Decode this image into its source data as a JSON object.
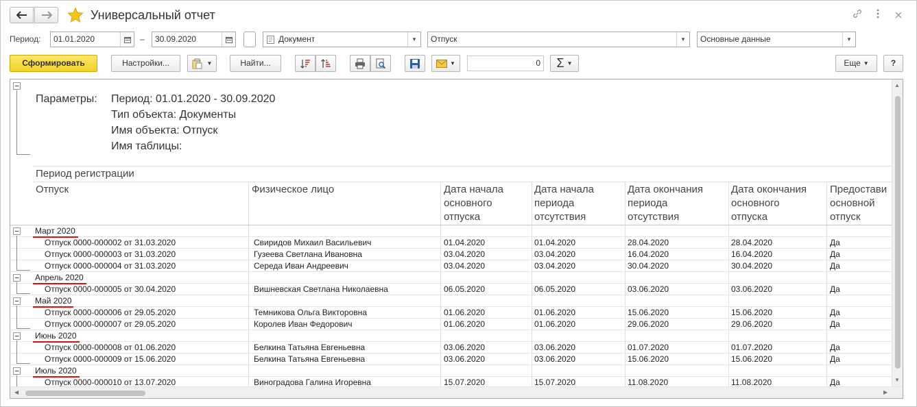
{
  "window": {
    "title": "Универсальный отчет"
  },
  "filters": {
    "period_label": "Период:",
    "date_from": "01.01.2020",
    "date_sep": "–",
    "date_to": "30.09.2020",
    "object_type": "Документ",
    "object_name": "Отпуск",
    "table_name": "Основные данные"
  },
  "toolbar": {
    "generate_label": "Сформировать",
    "settings_label": "Настройки...",
    "find_label": "Найти...",
    "sum_value": "0",
    "sigma": "Σ",
    "more_label": "Еще",
    "help_label": "?"
  },
  "report": {
    "params_label": "Параметры:",
    "param_lines": [
      "Период: 01.01.2020 - 30.09.2020",
      "Тип объекта: Документы",
      "Имя объекта: Отпуск",
      "Имя таблицы:"
    ],
    "group_header": "Период регистрации",
    "columns": [
      "Отпуск",
      "Физическое лицо",
      "Дата начала основного отпуска",
      "Дата начала периода отсутствия",
      "Дата окончания периода отсутствия",
      "Дата окончания основного отпуска",
      "Предоставить основной отпуск"
    ],
    "column_lines": [
      [
        "Отпуск"
      ],
      [
        "Физическое лицо"
      ],
      [
        "Дата начала",
        "основного",
        "отпуска"
      ],
      [
        "Дата начала",
        "периода",
        "отсутствия"
      ],
      [
        "Дата окончания",
        "периода",
        "отсутствия"
      ],
      [
        "Дата окончания",
        "основного",
        "отпуска"
      ],
      [
        "Предостави",
        "основной",
        "отпуск"
      ]
    ],
    "groups": [
      {
        "name": "Март 2020",
        "rows": [
          [
            "Отпуск 0000-000002 от 31.03.2020",
            "Свиридов Михаил Васильевич",
            "01.04.2020",
            "01.04.2020",
            "28.04.2020",
            "28.04.2020",
            "Да"
          ],
          [
            "Отпуск 0000-000003 от 31.03.2020",
            "Гузеева Светлана Ивановна",
            "03.04.2020",
            "03.04.2020",
            "16.04.2020",
            "16.04.2020",
            "Да"
          ],
          [
            "Отпуск 0000-000004 от 31.03.2020",
            "Середа Иван Андреевич",
            "03.04.2020",
            "03.04.2020",
            "30.04.2020",
            "30.04.2020",
            "Да"
          ]
        ]
      },
      {
        "name": "Апрель 2020",
        "rows": [
          [
            "Отпуск 0000-000005 от 30.04.2020",
            "Вишневская Светлана Николаевна",
            "06.05.2020",
            "06.05.2020",
            "03.06.2020",
            "03.06.2020",
            "Да"
          ]
        ]
      },
      {
        "name": "Май 2020",
        "rows": [
          [
            "Отпуск 0000-000006 от 29.05.2020",
            "Темникова Ольга Викторовна",
            "01.06.2020",
            "01.06.2020",
            "15.06.2020",
            "15.06.2020",
            "Да"
          ],
          [
            "Отпуск 0000-000007 от 29.05.2020",
            "Королев Иван Федорович",
            "01.06.2020",
            "01.06.2020",
            "29.06.2020",
            "29.06.2020",
            "Да"
          ]
        ]
      },
      {
        "name": "Июнь 2020",
        "rows": [
          [
            "Отпуск 0000-000008 от 01.06.2020",
            "Белкина Татьяна Евгеньевна",
            "03.06.2020",
            "03.06.2020",
            "01.07.2020",
            "01.07.2020",
            "Да"
          ],
          [
            "Отпуск 0000-000009 от 15.06.2020",
            "Белкина Татьяна Евгеньевна",
            "03.06.2020",
            "03.06.2020",
            "15.06.2020",
            "15.06.2020",
            "Да"
          ]
        ]
      },
      {
        "name": "Июль 2020",
        "rows": [
          [
            "Отпуск 0000-000010 от 13.07.2020",
            "Виноградова Галина Игоревна",
            "15.07.2020",
            "15.07.2020",
            "11.08.2020",
            "11.08.2020",
            "Да"
          ]
        ]
      }
    ]
  },
  "colors": {
    "primary_button": "#f2d024",
    "annotation_underline": "#e01010",
    "favorite_star": "#f5c518"
  },
  "icons": [
    "back-arrow-icon",
    "forward-arrow-icon",
    "favorite-star-icon",
    "link-icon",
    "more-vertical-icon",
    "close-icon",
    "calendar-icon",
    "print-icon",
    "preview-icon",
    "save-icon",
    "mail-icon",
    "sort-asc-icon",
    "sort-desc-icon",
    "variants-icon"
  ]
}
